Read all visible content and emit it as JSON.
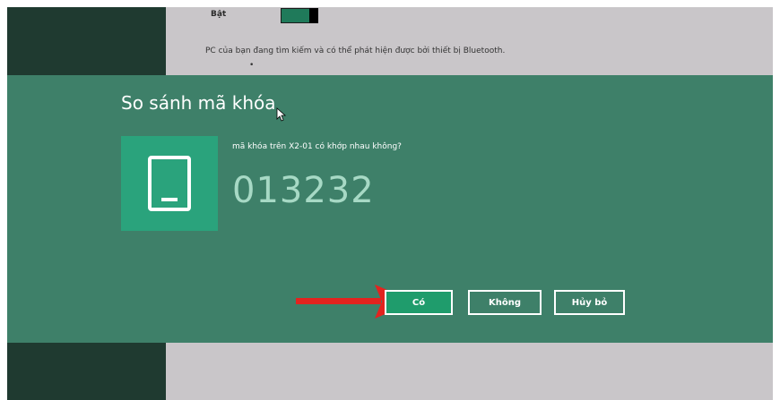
{
  "background": {
    "toggle_label": "Bật",
    "bluetooth_status": "PC của bạn đang tìm kiếm và có thể phát hiện được bởi thiết bị Bluetooth.",
    "tiny_mark": "•"
  },
  "dialog": {
    "title": "So sánh mã khóa",
    "prompt": "mã khóa trên X2-01 có khớp nhau không?",
    "passkey": "013232",
    "buttons": {
      "yes": "Có",
      "no": "Không",
      "cancel": "Hủy bỏ"
    },
    "colors": {
      "dialog_bg": "#3e8069",
      "tile_bg": "#2aa37c",
      "passkey_color": "#a7d9c5",
      "primary_button": "#1f9c6c"
    }
  },
  "icons": {
    "device": "phone-icon",
    "cursor": "mouse-cursor-icon",
    "annotation": "red-arrow-icon"
  }
}
